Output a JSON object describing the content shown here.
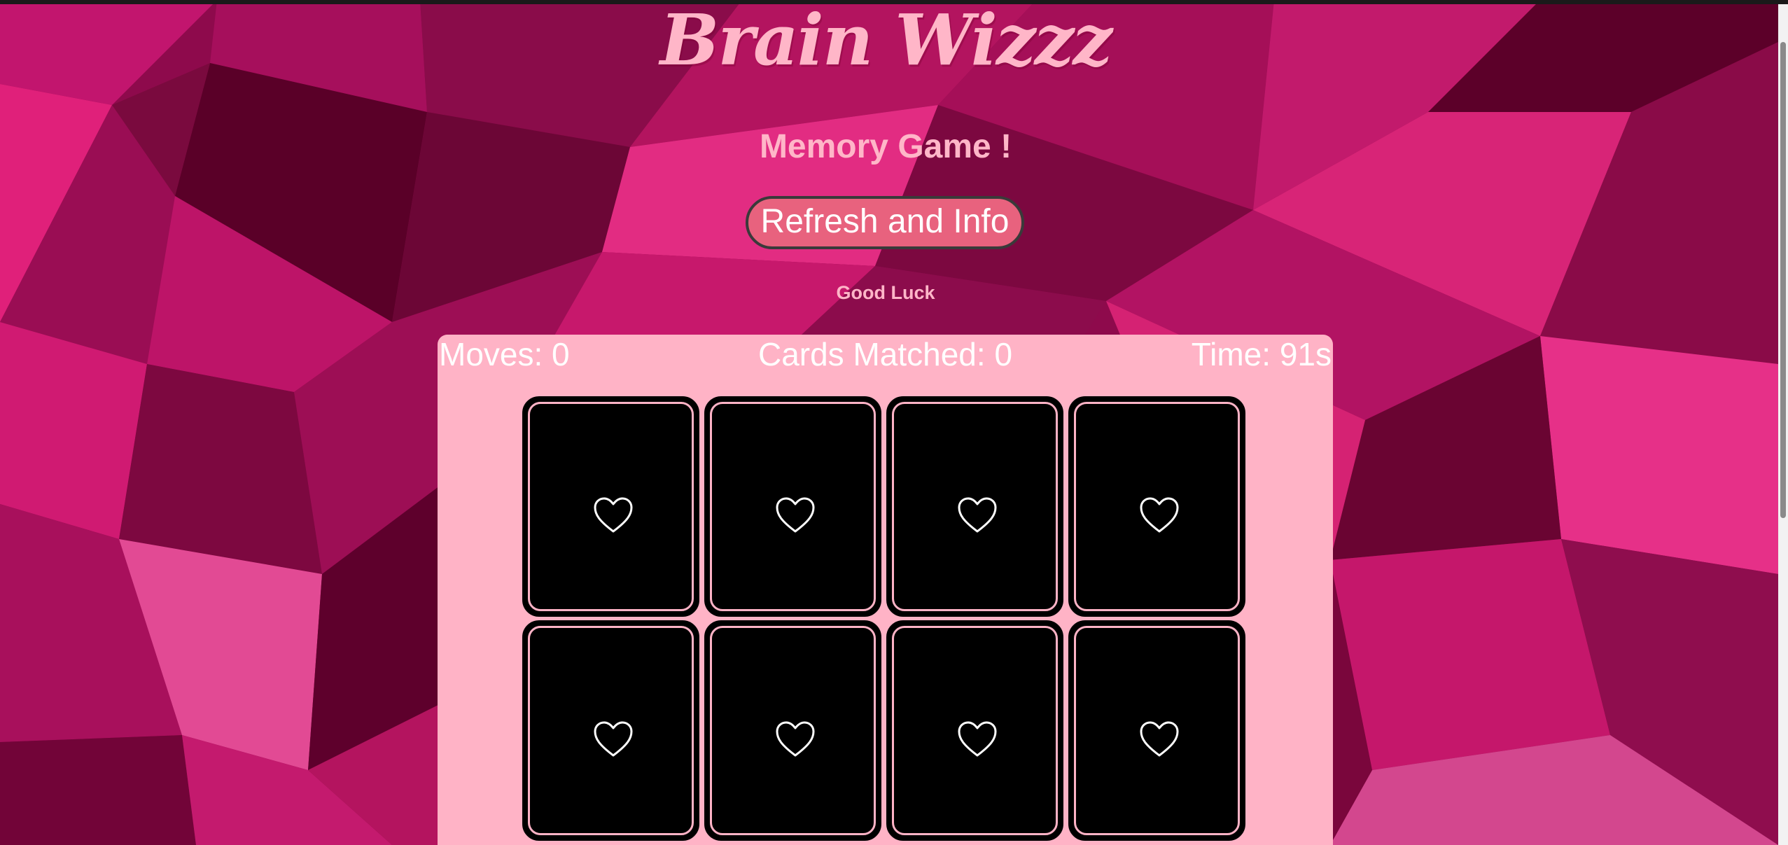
{
  "header": {
    "title": "Brain Wizzz",
    "subtitle": "Memory Game !",
    "refresh_button_label": "Refresh and Info",
    "tagline": "Good Luck"
  },
  "stats": {
    "moves": "Moves: 0",
    "cards_matched": "Cards Matched: 0",
    "time": "Time: 91s"
  },
  "cards": [
    {
      "state": "face-down",
      "icon": "heart-outline-icon"
    },
    {
      "state": "face-down",
      "icon": "heart-outline-icon"
    },
    {
      "state": "face-down",
      "icon": "heart-outline-icon"
    },
    {
      "state": "face-down",
      "icon": "heart-outline-icon"
    },
    {
      "state": "face-down",
      "icon": "heart-outline-icon"
    },
    {
      "state": "face-down",
      "icon": "heart-outline-icon"
    },
    {
      "state": "face-down",
      "icon": "heart-outline-icon"
    },
    {
      "state": "face-down",
      "icon": "heart-outline-icon"
    }
  ],
  "colors": {
    "background_dark": "#5a0028",
    "background_mid": "#a0105c",
    "background_light": "#e0207a",
    "title_pink": "#ffb6c8",
    "button_fill": "#e8627e",
    "board_pink": "#ffb3c6",
    "card_back": "#000000"
  }
}
